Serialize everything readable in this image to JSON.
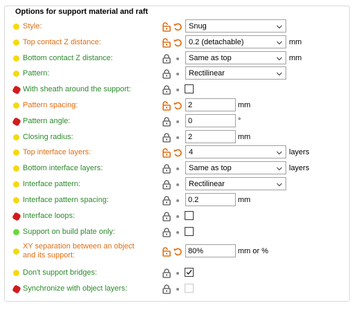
{
  "group": {
    "title": "Options for support material and raft"
  },
  "rows": [
    {
      "label": "Style:",
      "dot": "yellow",
      "label_color": "orange",
      "lock": "unlocked",
      "reset": true,
      "control": "combo",
      "value": "Snug",
      "width": 146,
      "unit": ""
    },
    {
      "label": "Top contact Z distance:",
      "dot": "yellow",
      "label_color": "orange",
      "lock": "unlocked",
      "reset": true,
      "control": "combo",
      "value": "0.2 (detachable)",
      "width": 146,
      "unit": "mm"
    },
    {
      "label": "Bottom contact Z distance:",
      "dot": "yellow",
      "label_color": "green",
      "lock": "locked",
      "reset": false,
      "control": "combo",
      "value": "Same as top",
      "width": 146,
      "unit": "mm"
    },
    {
      "label": "Pattern:",
      "dot": "yellow",
      "label_color": "green",
      "lock": "locked",
      "reset": false,
      "control": "combo",
      "value": "Rectilinear",
      "width": 146,
      "unit": ""
    },
    {
      "label": "With sheath around the support:",
      "dot": "red",
      "label_color": "green",
      "lock": "locked",
      "reset": false,
      "control": "check",
      "checked": false,
      "disabled": false
    },
    {
      "label": "Pattern spacing:",
      "dot": "yellow",
      "label_color": "orange",
      "lock": "unlocked",
      "reset": true,
      "control": "field",
      "value": "2",
      "unit": "mm"
    },
    {
      "label": "Pattern angle:",
      "dot": "red",
      "label_color": "green",
      "lock": "locked",
      "reset": false,
      "control": "field",
      "value": "0",
      "unit": "°"
    },
    {
      "label": "Closing radius:",
      "dot": "yellow",
      "label_color": "green",
      "lock": "locked",
      "reset": false,
      "control": "field",
      "value": "2",
      "unit": "mm"
    },
    {
      "label": "Top interface layers:",
      "dot": "yellow",
      "label_color": "orange",
      "lock": "unlocked",
      "reset": true,
      "control": "combo",
      "value": "4",
      "width": 146,
      "unit": "layers"
    },
    {
      "label": "Bottom interface layers:",
      "dot": "yellow",
      "label_color": "green",
      "lock": "locked",
      "reset": false,
      "control": "combo",
      "value": "Same as top",
      "width": 146,
      "unit": "layers"
    },
    {
      "label": "Interface pattern:",
      "dot": "yellow",
      "label_color": "green",
      "lock": "locked",
      "reset": false,
      "control": "combo",
      "value": "Rectilinear",
      "width": 146,
      "unit": ""
    },
    {
      "label": "Interface pattern spacing:",
      "dot": "yellow",
      "label_color": "green",
      "lock": "locked",
      "reset": false,
      "control": "field",
      "value": "0.2",
      "unit": "mm"
    },
    {
      "label": "Interface loops:",
      "dot": "red",
      "label_color": "green",
      "lock": "locked",
      "reset": false,
      "control": "check",
      "checked": false,
      "disabled": false
    },
    {
      "label": "Support on build plate only:",
      "dot": "green",
      "label_color": "green",
      "lock": "locked",
      "reset": false,
      "control": "check",
      "checked": false,
      "disabled": false
    },
    {
      "label": "XY separation between an object and its support:",
      "dot": "yellow",
      "label_color": "orange",
      "lock": "unlocked",
      "reset": true,
      "control": "field",
      "value": "80%",
      "unit": "mm or %",
      "wrap": true
    },
    {
      "label": "Don't support bridges:",
      "dot": "yellow",
      "label_color": "green",
      "lock": "locked",
      "reset": false,
      "control": "check",
      "checked": true,
      "disabled": false
    },
    {
      "label": "Synchronize with object layers:",
      "dot": "red",
      "label_color": "green",
      "lock": "locked",
      "reset": false,
      "control": "check",
      "checked": false,
      "disabled": true
    }
  ],
  "colors": {
    "accent_orange": "#e06d12",
    "label_green": "#2c8a2c",
    "lock_gray": "#6b6b6b"
  }
}
